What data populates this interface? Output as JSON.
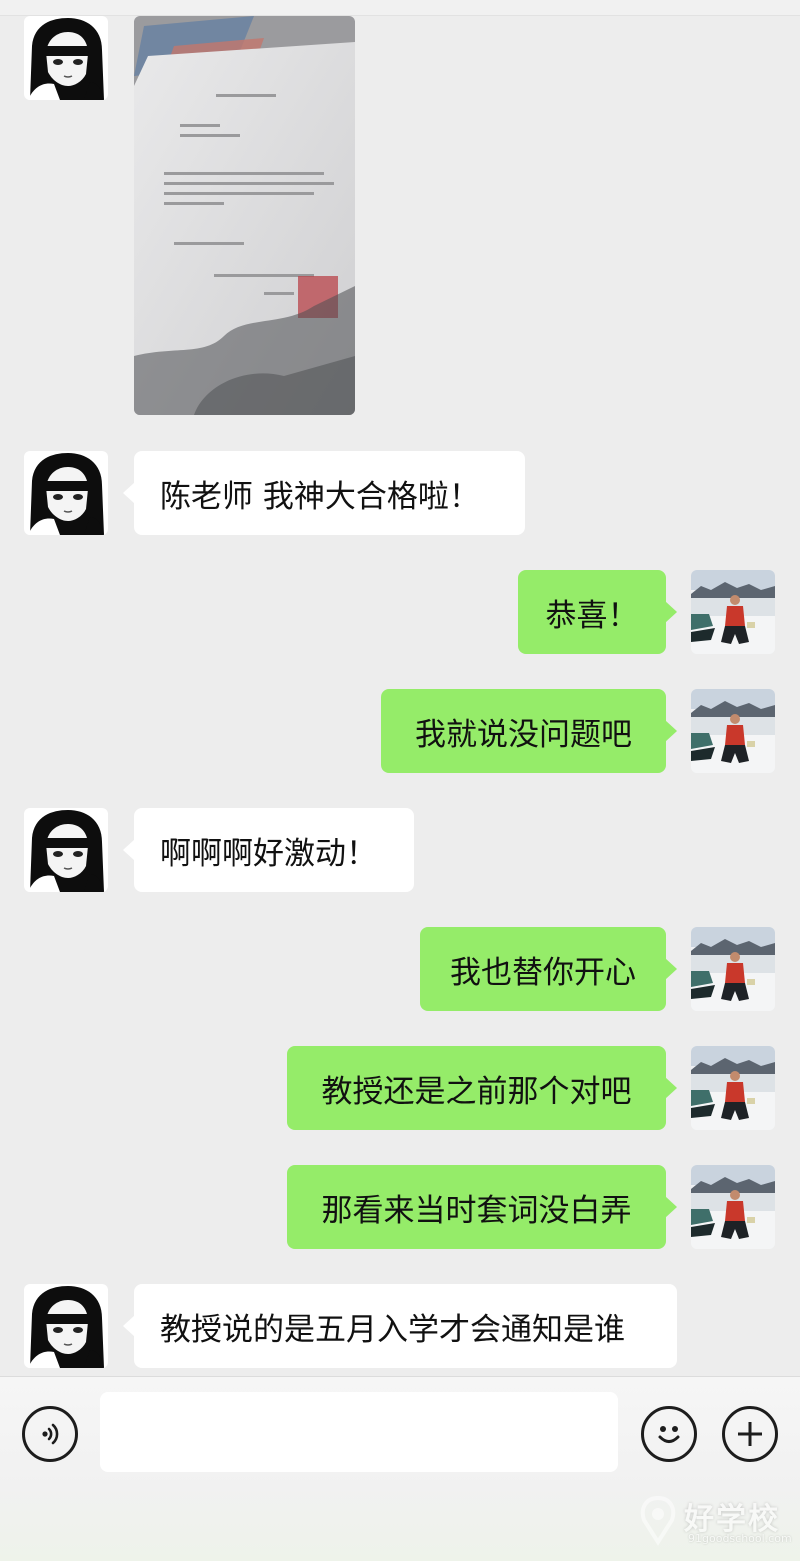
{
  "chat": {
    "messages": [
      {
        "side": "left",
        "type": "image",
        "avatar": "anime-girl-avatar"
      },
      {
        "side": "left",
        "type": "text",
        "text": "陈老师 我神大合格啦！"
      },
      {
        "side": "right",
        "type": "text",
        "text": "恭喜！"
      },
      {
        "side": "right",
        "type": "text",
        "text": "我就说没问题吧"
      },
      {
        "side": "left",
        "type": "text",
        "text": "啊啊啊好激动！"
      },
      {
        "side": "right",
        "type": "text",
        "text": "我也替你开心"
      },
      {
        "side": "right",
        "type": "text",
        "text": "教授还是之前那个对吧"
      },
      {
        "side": "right",
        "type": "text",
        "text": "那看来当时套词没白弄"
      },
      {
        "side": "left",
        "type": "text",
        "text": "教授说的是五月入学才会通知是谁"
      }
    ]
  },
  "input_bar": {
    "voice_icon": "voice-icon",
    "input_value": "",
    "emoji_icon": "emoji-icon",
    "plus_icon": "plus-icon"
  },
  "watermark": {
    "text": "好学校",
    "url": "91goodschool.com"
  },
  "colors": {
    "background": "#ededed",
    "outgoing_bubble": "#95ec69",
    "incoming_bubble": "#ffffff"
  }
}
